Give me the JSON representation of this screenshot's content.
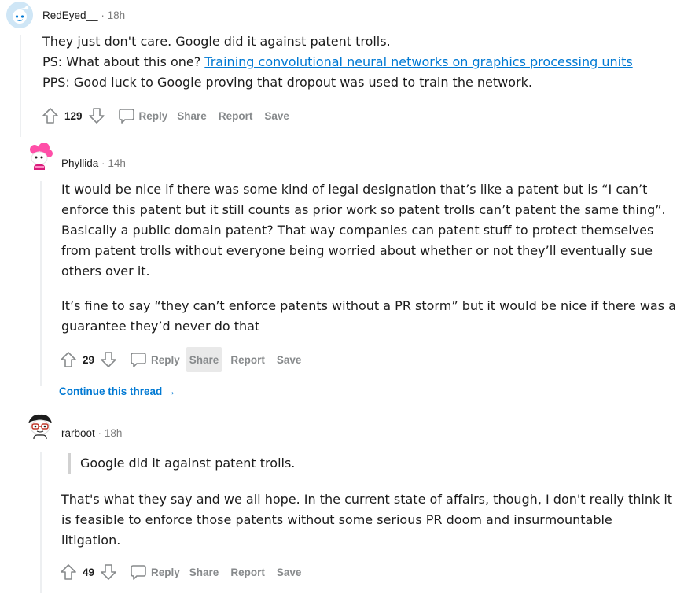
{
  "comments": [
    {
      "author": "RedEyed__",
      "age": "18h",
      "body_lines": [
        "They just don't care. Google did it against patent trolls."
      ],
      "ps_prefix": "PS: What about this one? ",
      "ps_link": "Training convolutional neural networks on graphics processing units",
      "pps_line": "PPS: Good luck to Google proving that dropout was used to train the network.",
      "score": "129"
    },
    {
      "author": "Phyllida",
      "age": "14h",
      "para1": [
        "It would be nice if there was some kind of legal designation that’s like a patent but is “I can’t",
        "enforce this patent but it still counts as prior work so patent trolls can’t patent the same thing”.",
        "Basically a public domain patent? That way companies can patent stuff to protect themselves",
        "from patent trolls without everyone being worried about whether or not they’ll eventually sue",
        "others over it."
      ],
      "para2": [
        "It’s fine to say “they can’t enforce patents without a PR storm” but it would be nice if there was a",
        "guarantee they’d never do that"
      ],
      "score": "29"
    },
    {
      "author": "rarboot",
      "age": "18h",
      "quote": "Google did it against patent trolls.",
      "para1": [
        "That's what they say and we all hope. In the current state of affairs, though, I don't really think it",
        "is feasible to enforce those patents without some serious PR doom and insurmountable",
        "litigation."
      ],
      "score": "49"
    }
  ],
  "actions": {
    "reply": "Reply",
    "share": "Share",
    "report": "Report",
    "save": "Save"
  },
  "separator": "·",
  "continue_thread": "Continue this thread",
  "continue_arrow": "→",
  "colors": {
    "link": "#0079d3",
    "meta_gray": "#7c7c7c",
    "action_gray": "#878a8c",
    "thread_line": "#edeff1",
    "hover_bg": "#e9e9e9"
  },
  "icons": [
    "upvote-icon",
    "downvote-icon",
    "comment-bubble-icon"
  ]
}
